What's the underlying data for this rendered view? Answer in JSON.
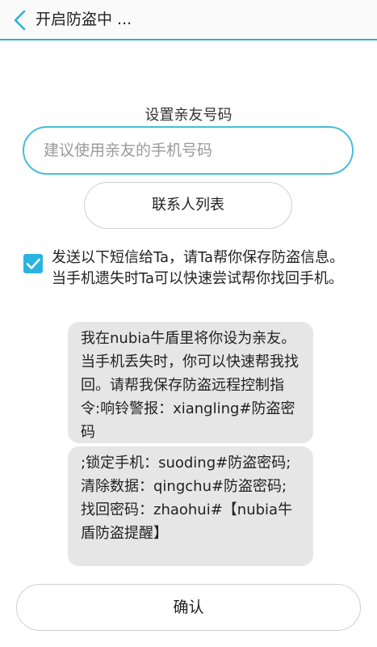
{
  "header": {
    "title": "开启防盗中 ...",
    "back_icon": "chevron-left-icon",
    "accent_color": "#2bb3d6"
  },
  "form": {
    "section_label": "设置亲友号码",
    "phone_placeholder": "建议使用亲友的手机号码",
    "phone_value": "",
    "contacts_button": "联系人列表"
  },
  "sms_option": {
    "checked": true,
    "text": "发送以下短信给Ta，请Ta帮你保存防盗信息。当手机遗失时Ta可以快速尝试帮你找回手机。"
  },
  "messages": [
    "我在nubia牛盾里将你设为亲友。当手机丢失时，你可以快速帮我找回。请帮我保存防盗远程控制指令:响铃警报：xiangling#防盗密码",
    ";锁定手机：suoding#防盗密码;清除数据：qingchu#防盗密码;找回密码：zhaohui#【nubia牛盾防盗提醒】"
  ],
  "footer": {
    "confirm_button": "确认"
  }
}
